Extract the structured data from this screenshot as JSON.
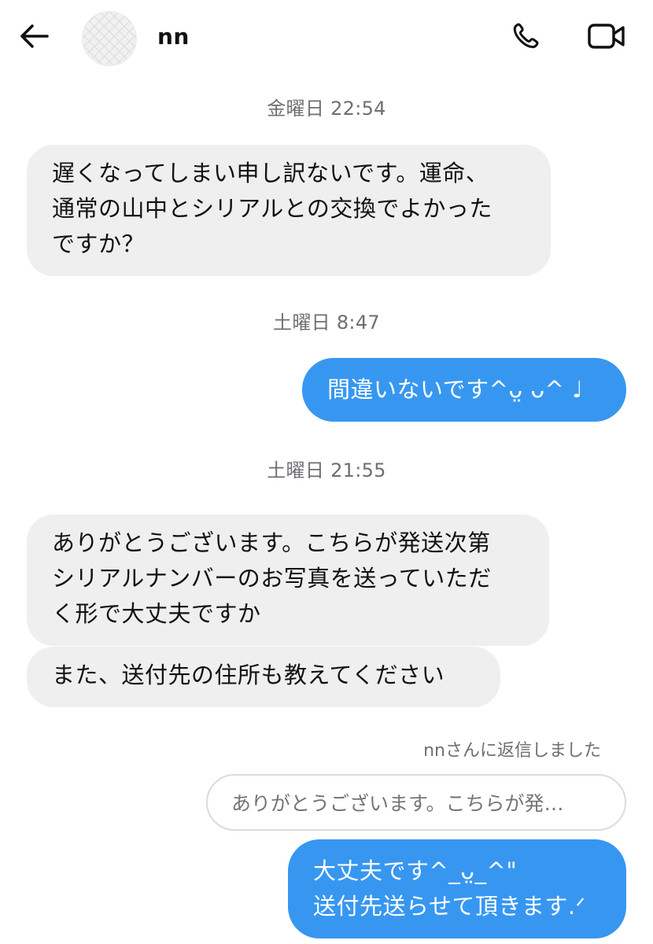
{
  "header": {
    "contact_name": "nn",
    "icons": {
      "back": "arrow-left-icon",
      "call": "phone-icon",
      "video": "video-camera-icon"
    }
  },
  "colors": {
    "incoming_bubble": "#efefef",
    "outgoing_bubble": "#3797f0",
    "timestamp_text": "#6e6e73"
  },
  "thread": {
    "timestamps": [
      "金曜日 22:54",
      "土曜日 8:47",
      "土曜日 21:55"
    ],
    "messages": [
      {
        "direction": "incoming",
        "lines": [
          "遅くなってしまい申し訳ないです。運命、",
          "通常の山中とシリアルとの交換でよかった",
          "ですか？"
        ]
      },
      {
        "direction": "outgoing",
        "lines": [
          "間違いないです^ᴗ̤ ᴗ^ ♩"
        ]
      },
      {
        "direction": "incoming",
        "lines": [
          "ありがとうございます。こちらが発送次第",
          "シリアルナンバーのお写真を送っていただ",
          "く形で大丈夫ですか"
        ]
      },
      {
        "direction": "incoming",
        "lines": [
          "また、送付先の住所も教えてください"
        ]
      },
      {
        "direction": "outgoing",
        "reply_label": "nnさんに返信しました",
        "reply_preview": "ありがとうございます。こちらが発…",
        "lines": [
          "大丈夫です^_ᴗ̤_^\"",
          "送付先送らせて頂きます.ᐟ"
        ]
      }
    ]
  }
}
